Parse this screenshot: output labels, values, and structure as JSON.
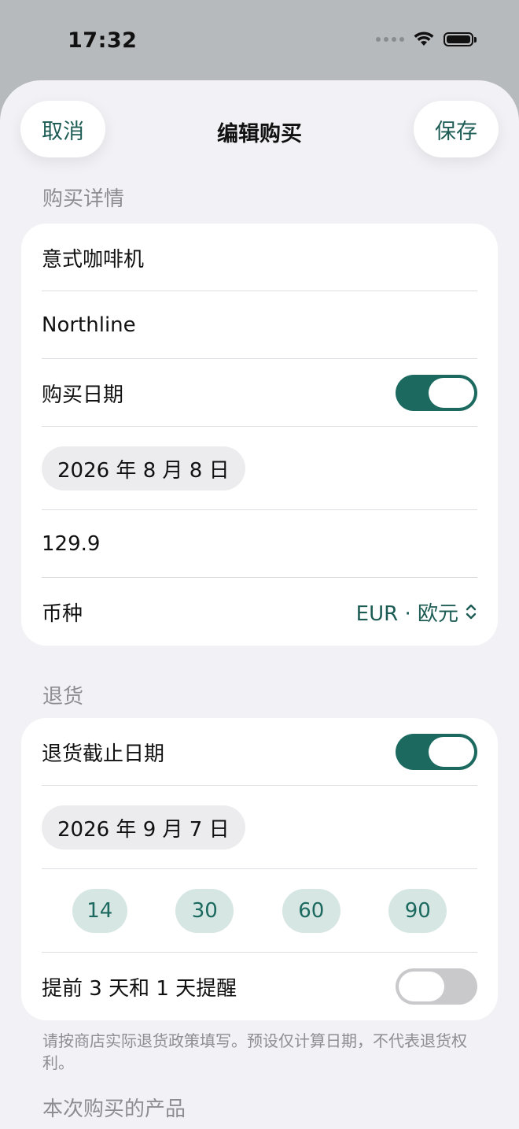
{
  "status_bar": {
    "time": "17:32"
  },
  "nav": {
    "cancel_label": "取消",
    "title": "编辑购买",
    "save_label": "保存"
  },
  "purchase_section": {
    "header": "购买详情",
    "product_name": "意式咖啡机",
    "store": "Northline",
    "purchase_date_label": "购买日期",
    "purchase_date_enabled": true,
    "purchase_date_value": "2026 年 8 月 8 日",
    "price": "129.9",
    "currency_label": "币种",
    "currency_value": "EUR · 欧元"
  },
  "return_section": {
    "header": "退货",
    "deadline_label": "退货截止日期",
    "deadline_enabled": true,
    "deadline_value": "2026 年 9 月 7 日",
    "day_presets": [
      "14",
      "30",
      "60",
      "90"
    ],
    "reminder_label": "提前 3 天和 1 天提醒",
    "reminder_enabled": false,
    "footnote": "请按商店实际退货政策填写。预设仅计算日期，不代表退货权利。"
  },
  "products_section": {
    "header": "本次购买的产品"
  },
  "colors": {
    "accent": "#1c6a5f",
    "background": "#f2f2f6",
    "card": "#ffffff"
  }
}
